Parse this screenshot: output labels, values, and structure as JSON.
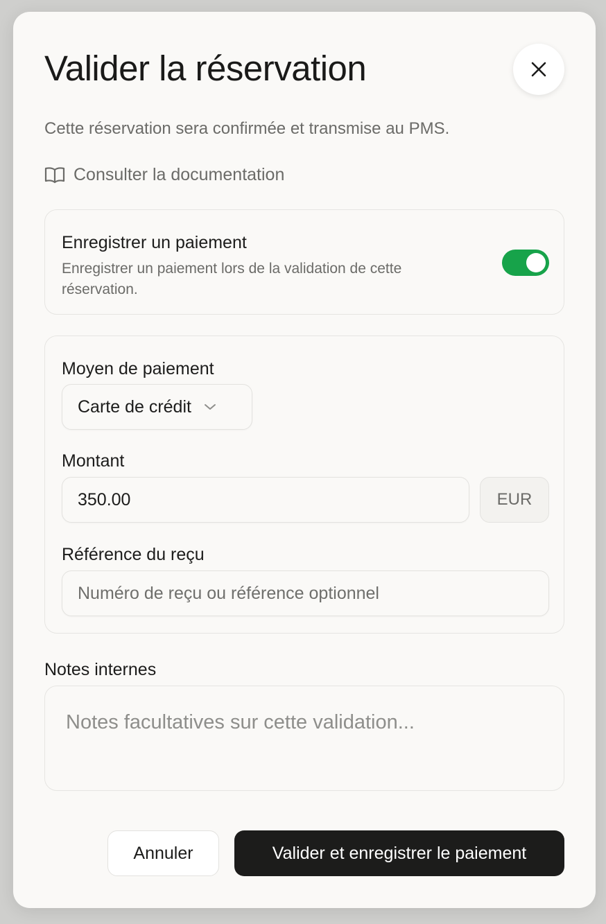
{
  "dialog": {
    "title": "Valider la réservation",
    "subtitle": "Cette réservation sera confirmée et transmise au PMS.",
    "doc_link": "Consulter la documentation"
  },
  "payment_toggle": {
    "title": "Enregistrer un paiement",
    "description": "Enregistrer un paiement lors de la validation de cette réservation.",
    "enabled": true,
    "color": "#17a34a"
  },
  "form": {
    "method_label": "Moyen de paiement",
    "method_value": "Carte de crédit",
    "amount_label": "Montant",
    "amount_value": "350.00",
    "currency": "EUR",
    "receipt_label": "Référence du reçu",
    "receipt_placeholder": "Numéro de reçu ou référence optionnel"
  },
  "notes": {
    "label": "Notes internes",
    "placeholder": "Notes facultatives sur cette validation..."
  },
  "actions": {
    "cancel": "Annuler",
    "submit": "Valider et enregistrer le paiement"
  },
  "icons": {
    "close": "close-icon",
    "book": "book-icon",
    "chevron": "chevron-down-icon"
  }
}
